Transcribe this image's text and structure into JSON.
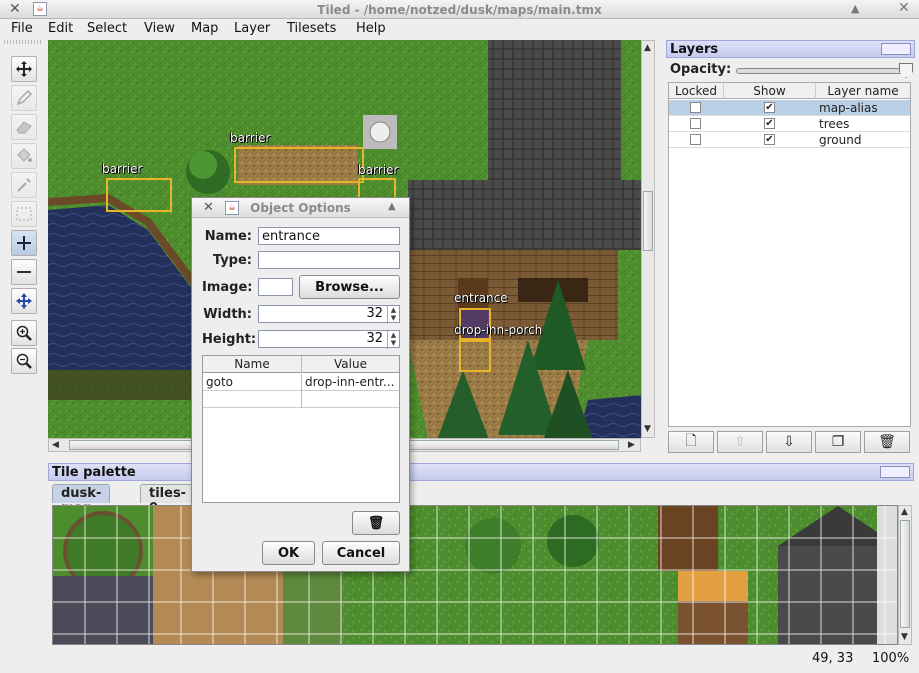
{
  "window": {
    "title": "Tiled - /home/notzed/dusk/maps/main.tmx"
  },
  "menu": [
    "File",
    "Edit",
    "Select",
    "View",
    "Map",
    "Layer",
    "Tilesets",
    "Help"
  ],
  "tools": [
    "move-icon",
    "pencil-icon",
    "eraser-icon",
    "bucket-fill-icon",
    "eyedropper-icon",
    "marquee-select-icon",
    "insert-object-icon",
    "remove-object-icon",
    "move-object-icon",
    "zoom-in-icon",
    "zoom-out-icon"
  ],
  "map_objects": [
    {
      "name": "barrier"
    },
    {
      "name": "barrier"
    },
    {
      "name": "barrier"
    },
    {
      "name": "entrance"
    },
    {
      "name": "drop-inn-porch"
    }
  ],
  "layers_panel": {
    "title": "Layers",
    "opacity_label": "Opacity:",
    "opacity_value": 1.0,
    "columns": [
      "Locked",
      "Show",
      "Layer name"
    ],
    "rows": [
      {
        "name": "map-alias",
        "locked": false,
        "show": true,
        "selected": true
      },
      {
        "name": "trees",
        "locked": false,
        "show": true,
        "selected": false
      },
      {
        "name": "ground",
        "locked": false,
        "show": true,
        "selected": false
      }
    ],
    "buttons": [
      "new-layer-icon",
      "move-layer-up-icon",
      "move-layer-down-icon",
      "duplicate-layer-icon",
      "delete-layer-icon"
    ]
  },
  "tile_palette": {
    "title": "Tile palette",
    "tabs": [
      "dusk-map",
      "tiles-0"
    ]
  },
  "status": {
    "coords": "49, 33",
    "zoom": "100%"
  },
  "dialog": {
    "title": "Object Options",
    "name_label": "Name:",
    "name_value": "entrance",
    "type_label": "Type:",
    "type_value": "",
    "image_label": "Image:",
    "browse_label": "Browse...",
    "width_label": "Width:",
    "width_value": "32",
    "height_label": "Height:",
    "height_value": "32",
    "prop_columns": [
      "Name",
      "Value"
    ],
    "props": [
      {
        "name": "goto",
        "value": "drop-inn-entr..."
      }
    ],
    "ok_label": "OK",
    "cancel_label": "Cancel"
  }
}
